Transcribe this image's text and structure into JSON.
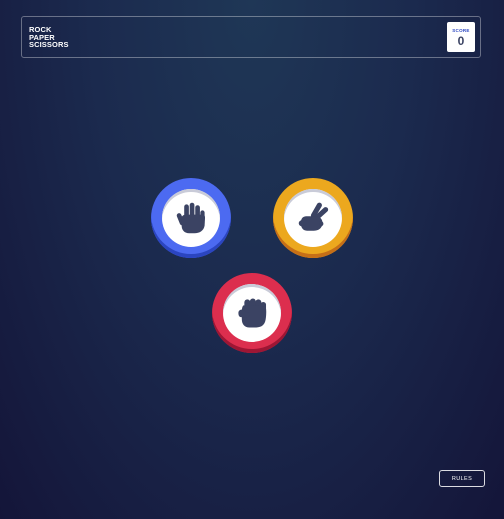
{
  "header": {
    "title_lines": [
      "ROCK",
      "PAPER",
      "SCISSORS"
    ],
    "score_label": "SCORE",
    "score_value": "0"
  },
  "tokens": [
    {
      "choice": "paper",
      "icon": "hand-paper-icon",
      "ring_color": "#4c6af1"
    },
    {
      "choice": "scissors",
      "icon": "hand-scissors-icon",
      "ring_color": "#eca81e"
    },
    {
      "choice": "rock",
      "icon": "hand-rock-icon",
      "ring_color": "#dc2e4e"
    }
  ],
  "footer": {
    "rules_label": "RULES"
  },
  "colors": {
    "icon_fill": "#3b4363",
    "background_top": "#1f3756",
    "background_bottom": "#141539"
  }
}
